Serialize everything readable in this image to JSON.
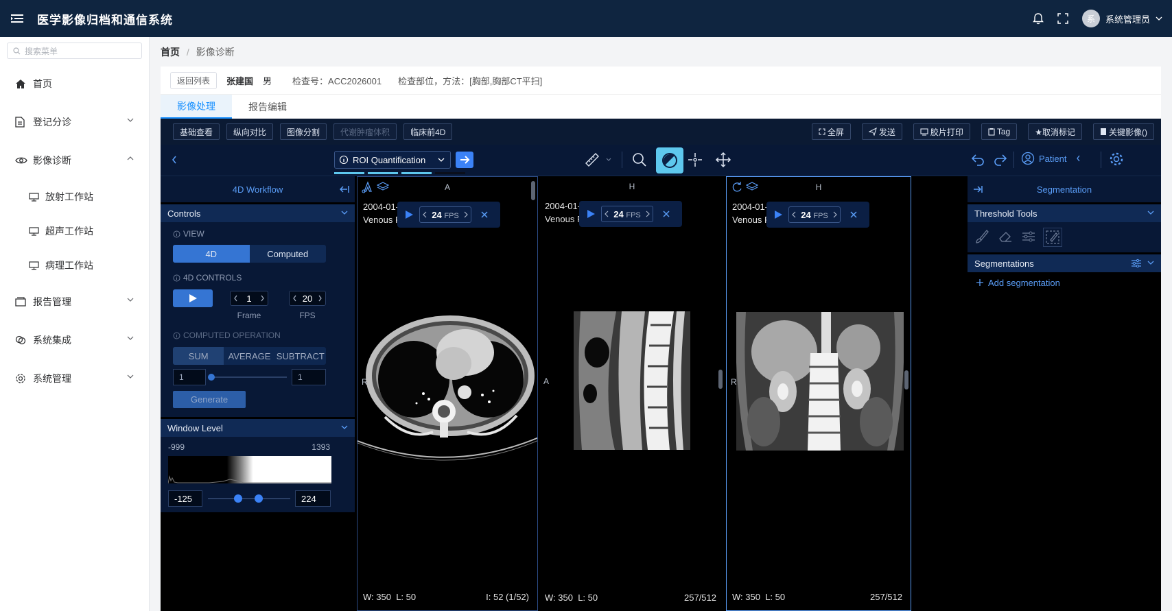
{
  "header": {
    "title": "医学影像归档和通信系统",
    "user_name": "系统管理员",
    "avatar_text": "系"
  },
  "sidebar": {
    "search_placeholder": "搜索菜单",
    "items": [
      {
        "label": "首页",
        "icon": "home-icon"
      },
      {
        "label": "登记分诊",
        "icon": "document-icon"
      },
      {
        "label": "影像诊断",
        "icon": "eye-icon"
      },
      {
        "label": "报告管理",
        "icon": "folder-icon"
      },
      {
        "label": "系统集成",
        "icon": "integration-icon"
      },
      {
        "label": "系统管理",
        "icon": "gear-icon"
      }
    ],
    "subitems": [
      {
        "label": "放射工作站"
      },
      {
        "label": "超声工作站"
      },
      {
        "label": "病理工作站"
      }
    ]
  },
  "breadcrumb": {
    "home": "首页",
    "sep": "/",
    "current": "影像诊断"
  },
  "patient": {
    "back_button": "返回列表",
    "name": "张建国",
    "sex": "男",
    "exam_no": "检查号：ACC2026001",
    "exam_part": "检查部位，方法：[胸部,胸部CT平扫]"
  },
  "tabs": [
    "影像处理",
    "报告编辑"
  ],
  "toolbar": {
    "left": [
      "基础查看",
      "纵向对比",
      "图像分割",
      "代谢肿瘤体积",
      "临床前4D"
    ],
    "right": [
      "全屏",
      "发送",
      "胶片打印",
      "Tag",
      "★取消标记",
      "关键影像()"
    ]
  },
  "tools": {
    "roi_label": "ROI Quantification",
    "patient_label": "Patient"
  },
  "left_panel": {
    "title": "4D Workflow",
    "controls": "Controls",
    "view_label": "VIEW",
    "view_options": [
      "4D",
      "Computed"
    ],
    "controls_label": "4D CONTROLS",
    "frame_value": "1",
    "frame_label": "Frame",
    "fps_value": "20",
    "fps_label": "FPS",
    "computed_label": "COMPUTED OPERATION",
    "operations": [
      "SUM",
      "AVERAGE",
      "SUBTRACT"
    ],
    "range_start": "1",
    "range_end": "1",
    "generate_label": "Generate",
    "window_level": "Window Level",
    "hist_min": "-999",
    "hist_max": "1393",
    "wl_low": "-125",
    "wl_high": "224",
    "wl_low_fraction": 0.37,
    "wl_high_fraction": 0.52
  },
  "viewports": [
    {
      "orientation_top": "A",
      "orientation_left": "R",
      "date": "2004-01-",
      "series": "Venous P",
      "fps": "24",
      "fps_unit": "FPS",
      "w": "W: 350",
      "l": "L: 50",
      "index": "I: 52 (1/52)"
    },
    {
      "orientation_top": "H",
      "orientation_left": "A",
      "date": "2004-01-",
      "series": "Venous P",
      "fps": "24",
      "fps_unit": "FPS",
      "w": "W: 350",
      "l": "L: 50",
      "index": "257/512"
    },
    {
      "orientation_top": "H",
      "orientation_left": "R",
      "date": "2004-01-",
      "series": "Venous P",
      "fps": "24",
      "fps_unit": "FPS",
      "w": "W: 350",
      "l": "L: 50",
      "index": "257/512"
    }
  ],
  "right_panel": {
    "title": "Segmentation",
    "threshold_tools": "Threshold Tools",
    "segmentations": "Segmentations",
    "add_segmentation": "Add segmentation"
  },
  "colors": {
    "header_bg": "#0f2540",
    "accent": "#1890ff",
    "viewer_bg": "#081836",
    "active_tool": "#5ec8ee"
  }
}
